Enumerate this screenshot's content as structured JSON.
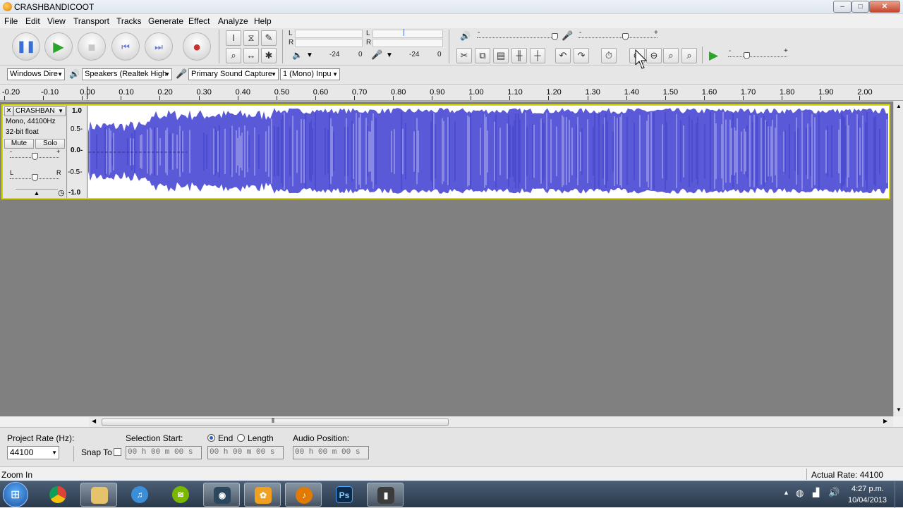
{
  "window": {
    "title": "CRASHBANDICOOT",
    "controls": {
      "minimize": "–",
      "maximize": "□",
      "close": "✕"
    }
  },
  "menu": [
    "File",
    "Edit",
    "View",
    "Transport",
    "Tracks",
    "Generate",
    "Effect",
    "Analyze",
    "Help"
  ],
  "meters": {
    "L": "L",
    "R": "R",
    "db_play": "-24",
    "zero_play": "0",
    "db_rec": "-24",
    "zero_rec": "0"
  },
  "device_toolbar": {
    "host": "Windows Dire",
    "output": "Speakers (Realtek High",
    "input": "Primary Sound Capture",
    "channels": "1 (Mono) Inpu"
  },
  "ruler": {
    "ticks": [
      "-0.20",
      "-0.10",
      "0.00",
      "0.10",
      "0.20",
      "0.30",
      "0.40",
      "0.50",
      "0.60",
      "0.70",
      "0.80",
      "0.90",
      "1.00",
      "1.10",
      "1.20",
      "1.30",
      "1.40",
      "1.50",
      "1.60",
      "1.70",
      "1.80",
      "1.90",
      "2.00"
    ]
  },
  "track": {
    "name": "CRASHBAN",
    "info1": "Mono, 44100Hz",
    "info2": "32-bit float",
    "mute": "Mute",
    "solo": "Solo",
    "gain_minus": "-",
    "gain_plus": "+",
    "pan_l": "L",
    "pan_r": "R",
    "vscale": [
      "1.0",
      "0.5-",
      "0.0-",
      "-0.5-",
      "-1.0"
    ],
    "wave_color": "#5a5ad8"
  },
  "selection_bar": {
    "project_rate_label": "Project Rate (Hz):",
    "project_rate": "44100",
    "snap_to": "Snap To",
    "selection_start_label": "Selection Start:",
    "end_label": "End",
    "length_label": "Length",
    "audio_position_label": "Audio Position:",
    "time_value": "00 h 00 m 00 s"
  },
  "status": {
    "left": "Zoom In",
    "right": "Actual Rate: 44100"
  },
  "taskbar": {
    "clock_time": "4:27 p.m.",
    "clock_date": "10/04/2013",
    "apps": [
      "windows-start",
      "chrome",
      "file-explorer",
      "itunes",
      "spotify",
      "steam",
      "fl-studio",
      "audacity",
      "photoshop",
      "media-app"
    ],
    "ps_label": "Ps"
  }
}
